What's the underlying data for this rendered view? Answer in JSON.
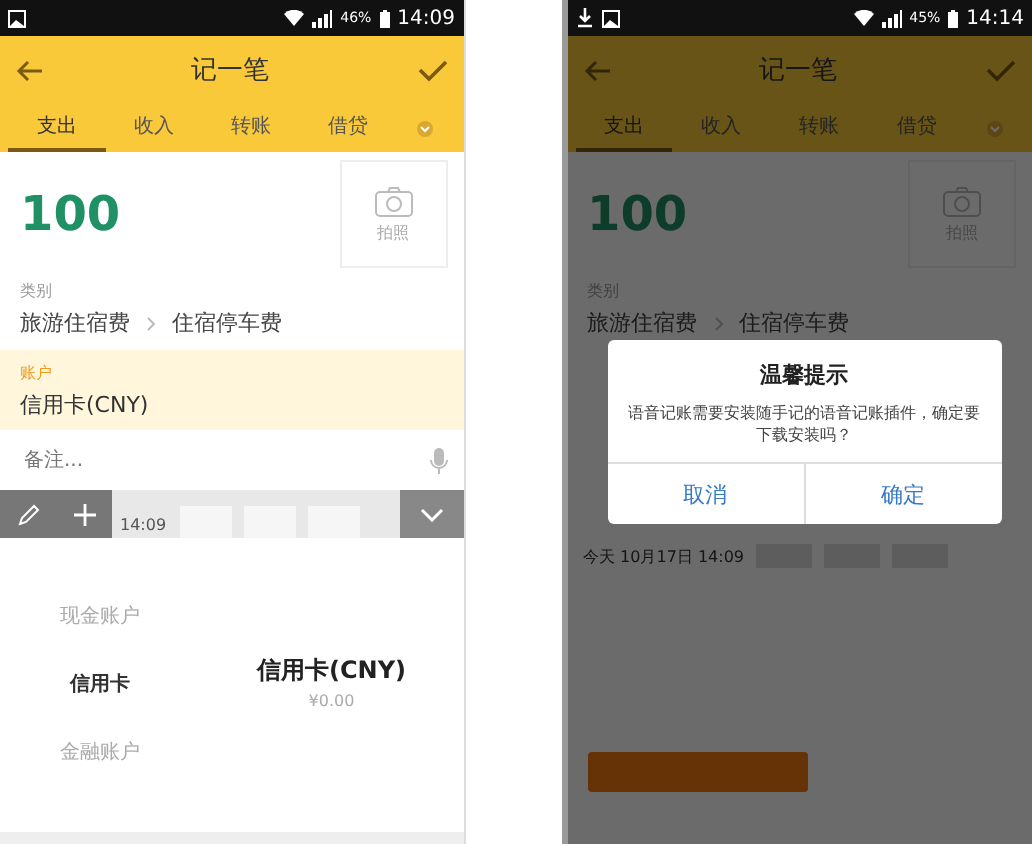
{
  "screens": [
    {
      "kind": "keyboard",
      "status": {
        "download": false,
        "battery": "46%",
        "time": "14:09"
      },
      "header": {
        "title": "记一笔"
      },
      "tabs": [
        {
          "label": "支出",
          "selected": true
        },
        {
          "label": "收入",
          "selected": false
        },
        {
          "label": "转账",
          "selected": false
        },
        {
          "label": "借贷",
          "selected": false
        }
      ],
      "amount": "100",
      "photo_label": "拍照",
      "category": {
        "label": "类别",
        "parent": "旅游住宿费",
        "child": "住宿停车费"
      },
      "account": {
        "label": "账户",
        "value": "信用卡(CNY)"
      },
      "note": {
        "placeholder": "备注..."
      },
      "toolbar": {
        "date": "14:09"
      },
      "picker": {
        "groups": [
          {
            "label": "现金账户",
            "selected": false
          },
          {
            "label": "信用卡",
            "selected": true
          },
          {
            "label": "金融账户",
            "selected": false
          }
        ],
        "account": "信用卡(CNY)",
        "balance": "¥0.00"
      }
    },
    {
      "kind": "dialog",
      "status": {
        "download": true,
        "battery": "45%",
        "time": "14:14"
      },
      "header": {
        "title": "记一笔"
      },
      "tabs": [
        {
          "label": "支出",
          "selected": true
        },
        {
          "label": "收入",
          "selected": false
        },
        {
          "label": "转账",
          "selected": false
        },
        {
          "label": "借贷",
          "selected": false
        }
      ],
      "amount": "100",
      "photo_label": "拍照",
      "category": {
        "label": "类别",
        "parent": "旅游住宿费",
        "child": "住宿停车费"
      },
      "date_row": {
        "date": "今天 10月17日 14:09"
      },
      "dialog": {
        "title": "温馨提示",
        "message": "语音记账需要安装随手记的语音记账插件，确定要下载安装吗？",
        "buttons": [
          "取消",
          "确定"
        ]
      }
    }
  ]
}
